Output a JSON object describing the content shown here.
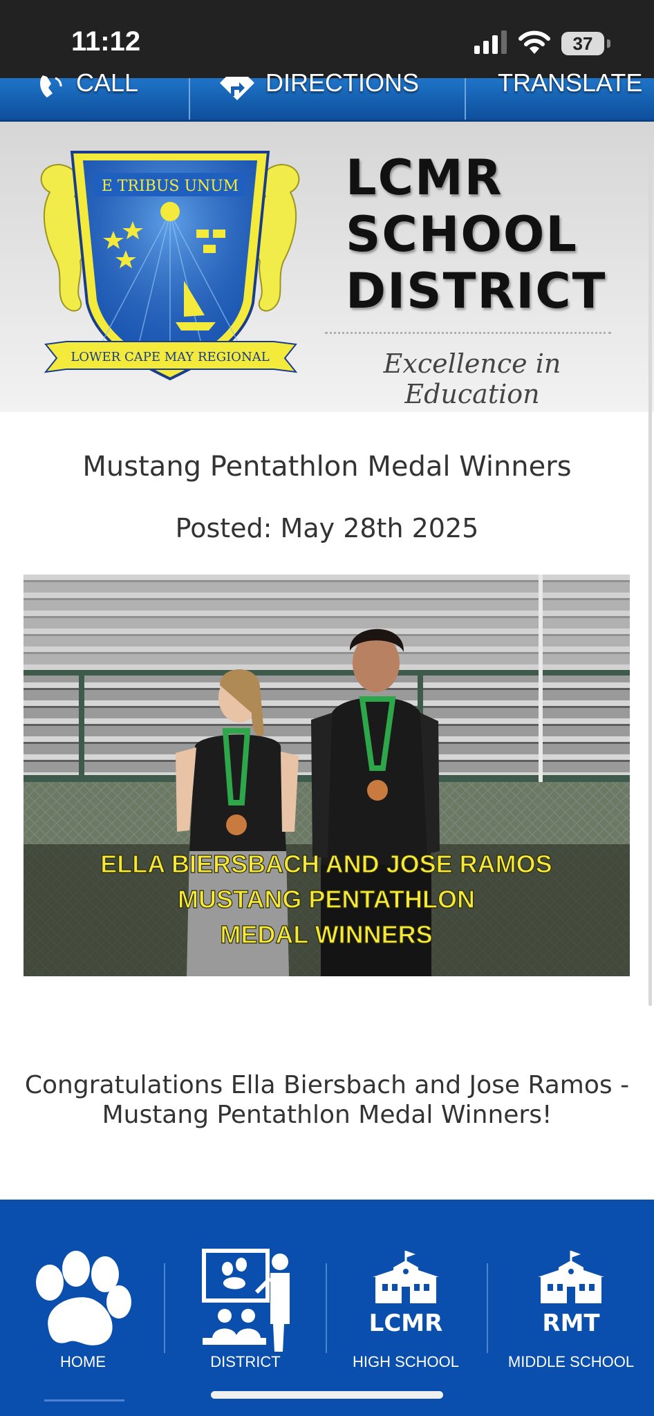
{
  "status_bar": {
    "time": "11:12",
    "battery": "37"
  },
  "action_bar": {
    "items": [
      {
        "label": "CALL",
        "icon": "phone-icon"
      },
      {
        "label": "DIRECTIONS",
        "icon": "directions-icon"
      },
      {
        "label": "TRANSLATE",
        "icon": ""
      }
    ]
  },
  "header": {
    "crest_motto": "E TRIBUS UNUM",
    "crest_ribbon": "LOWER CAPE MAY REGIONAL",
    "title_lines": [
      "LCMR",
      "SCHOOL",
      "DISTRICT"
    ],
    "tagline": "Excellence in Education"
  },
  "article": {
    "title": "Mustang Pentathlon Medal Winners",
    "posted": "Posted: May 28th 2025",
    "photo_caption": [
      "ELLA BIERSBACH AND JOSE RAMOS",
      "MUSTANG PENTATHLON",
      "MEDAL WINNERS"
    ],
    "body": "Congratulations Ella Biersbach and Jose Ramos - Mustang Pentathlon Medal Winners!"
  },
  "bottom_nav": {
    "items": [
      {
        "label": "HOME",
        "icon": "paw-icon"
      },
      {
        "label": "DISTRICT",
        "icon": "classroom-icon"
      },
      {
        "label": "HIGH SCHOOL",
        "icon": "school-building-icon",
        "badge": "LCMR"
      },
      {
        "label": "MIDDLE SCHOOL",
        "icon": "school-building-icon",
        "badge": "RMT"
      }
    ]
  },
  "colors": {
    "nav_blue": "#0a4fad",
    "action_bar_blue": "#1560b5",
    "caption_yellow": "#f5e83a"
  }
}
